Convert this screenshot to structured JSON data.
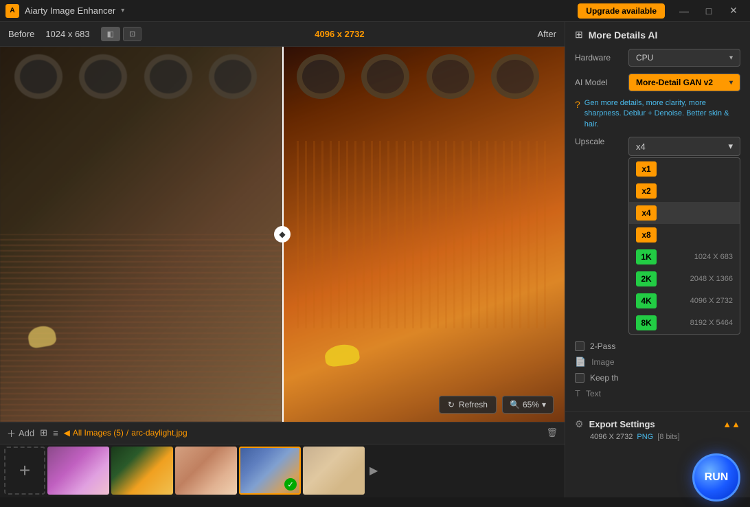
{
  "titlebar": {
    "logo": "A",
    "title": "Aiarty Image Enhancer",
    "arrow": "▾",
    "upgrade_label": "Upgrade available",
    "min_btn": "—",
    "max_btn": "□",
    "close_btn": "✕"
  },
  "viewer": {
    "before_label": "Before",
    "before_size": "1024 x 683",
    "after_size": "4096 x 2732",
    "after_label": "After",
    "view_btn1": "◧",
    "view_btn2": "⊡",
    "refresh_label": "Refresh",
    "zoom_label": "65%",
    "zoom_arrow": "▾"
  },
  "filmstrip": {
    "add_label": "Add",
    "view_label": "⊞",
    "list_label": "≡",
    "nav_back": "◀",
    "path_all": "All Images (5)",
    "path_file": "arc-daylight.jpg",
    "delete_icon": "🗑",
    "nav_next": "▶",
    "plus": "+"
  },
  "right_panel": {
    "section_icon": "⊞",
    "section_title": "More Details AI",
    "hardware_label": "Hardware",
    "hardware_value": "CPU",
    "hardware_arrow": "▾",
    "ai_model_label": "AI Model",
    "ai_model_value": "More-Detail GAN v2",
    "ai_model_arrow": "▾",
    "hint_text": "Gen more details, more clarity, more sharpness. Deblur + Denoise. Better skin & hair.",
    "upscale_label": "Upscale",
    "upscale_selected": "x4",
    "upscale_arrow": "▾",
    "upscale_options": [
      {
        "badge": "x1",
        "type": "orange",
        "label": "",
        "size": ""
      },
      {
        "badge": "x2",
        "type": "orange",
        "label": "",
        "size": ""
      },
      {
        "badge": "x4",
        "type": "orange",
        "label": "",
        "size": ""
      },
      {
        "badge": "x8",
        "type": "orange",
        "label": "",
        "size": ""
      },
      {
        "badge": "1K",
        "type": "green",
        "label": "",
        "size": "1024 X 683"
      },
      {
        "badge": "2K",
        "type": "green",
        "label": "",
        "size": "2048 X 1366"
      },
      {
        "badge": "4K",
        "type": "green",
        "label": "",
        "size": "4096 X 2732"
      },
      {
        "badge": "8K",
        "type": "green",
        "label": "",
        "size": "8192 X 5464"
      }
    ],
    "twopass_label": "2-Pass",
    "image_label": "Image",
    "keepth_label": "Keep th",
    "text_label": "Text",
    "export_title": "Export Settings",
    "export_size": "4096 X 2732",
    "export_format": "PNG",
    "export_bits": "[8 bits]",
    "run_label": "RUN",
    "collapse_arrows": "⌃⌃"
  }
}
